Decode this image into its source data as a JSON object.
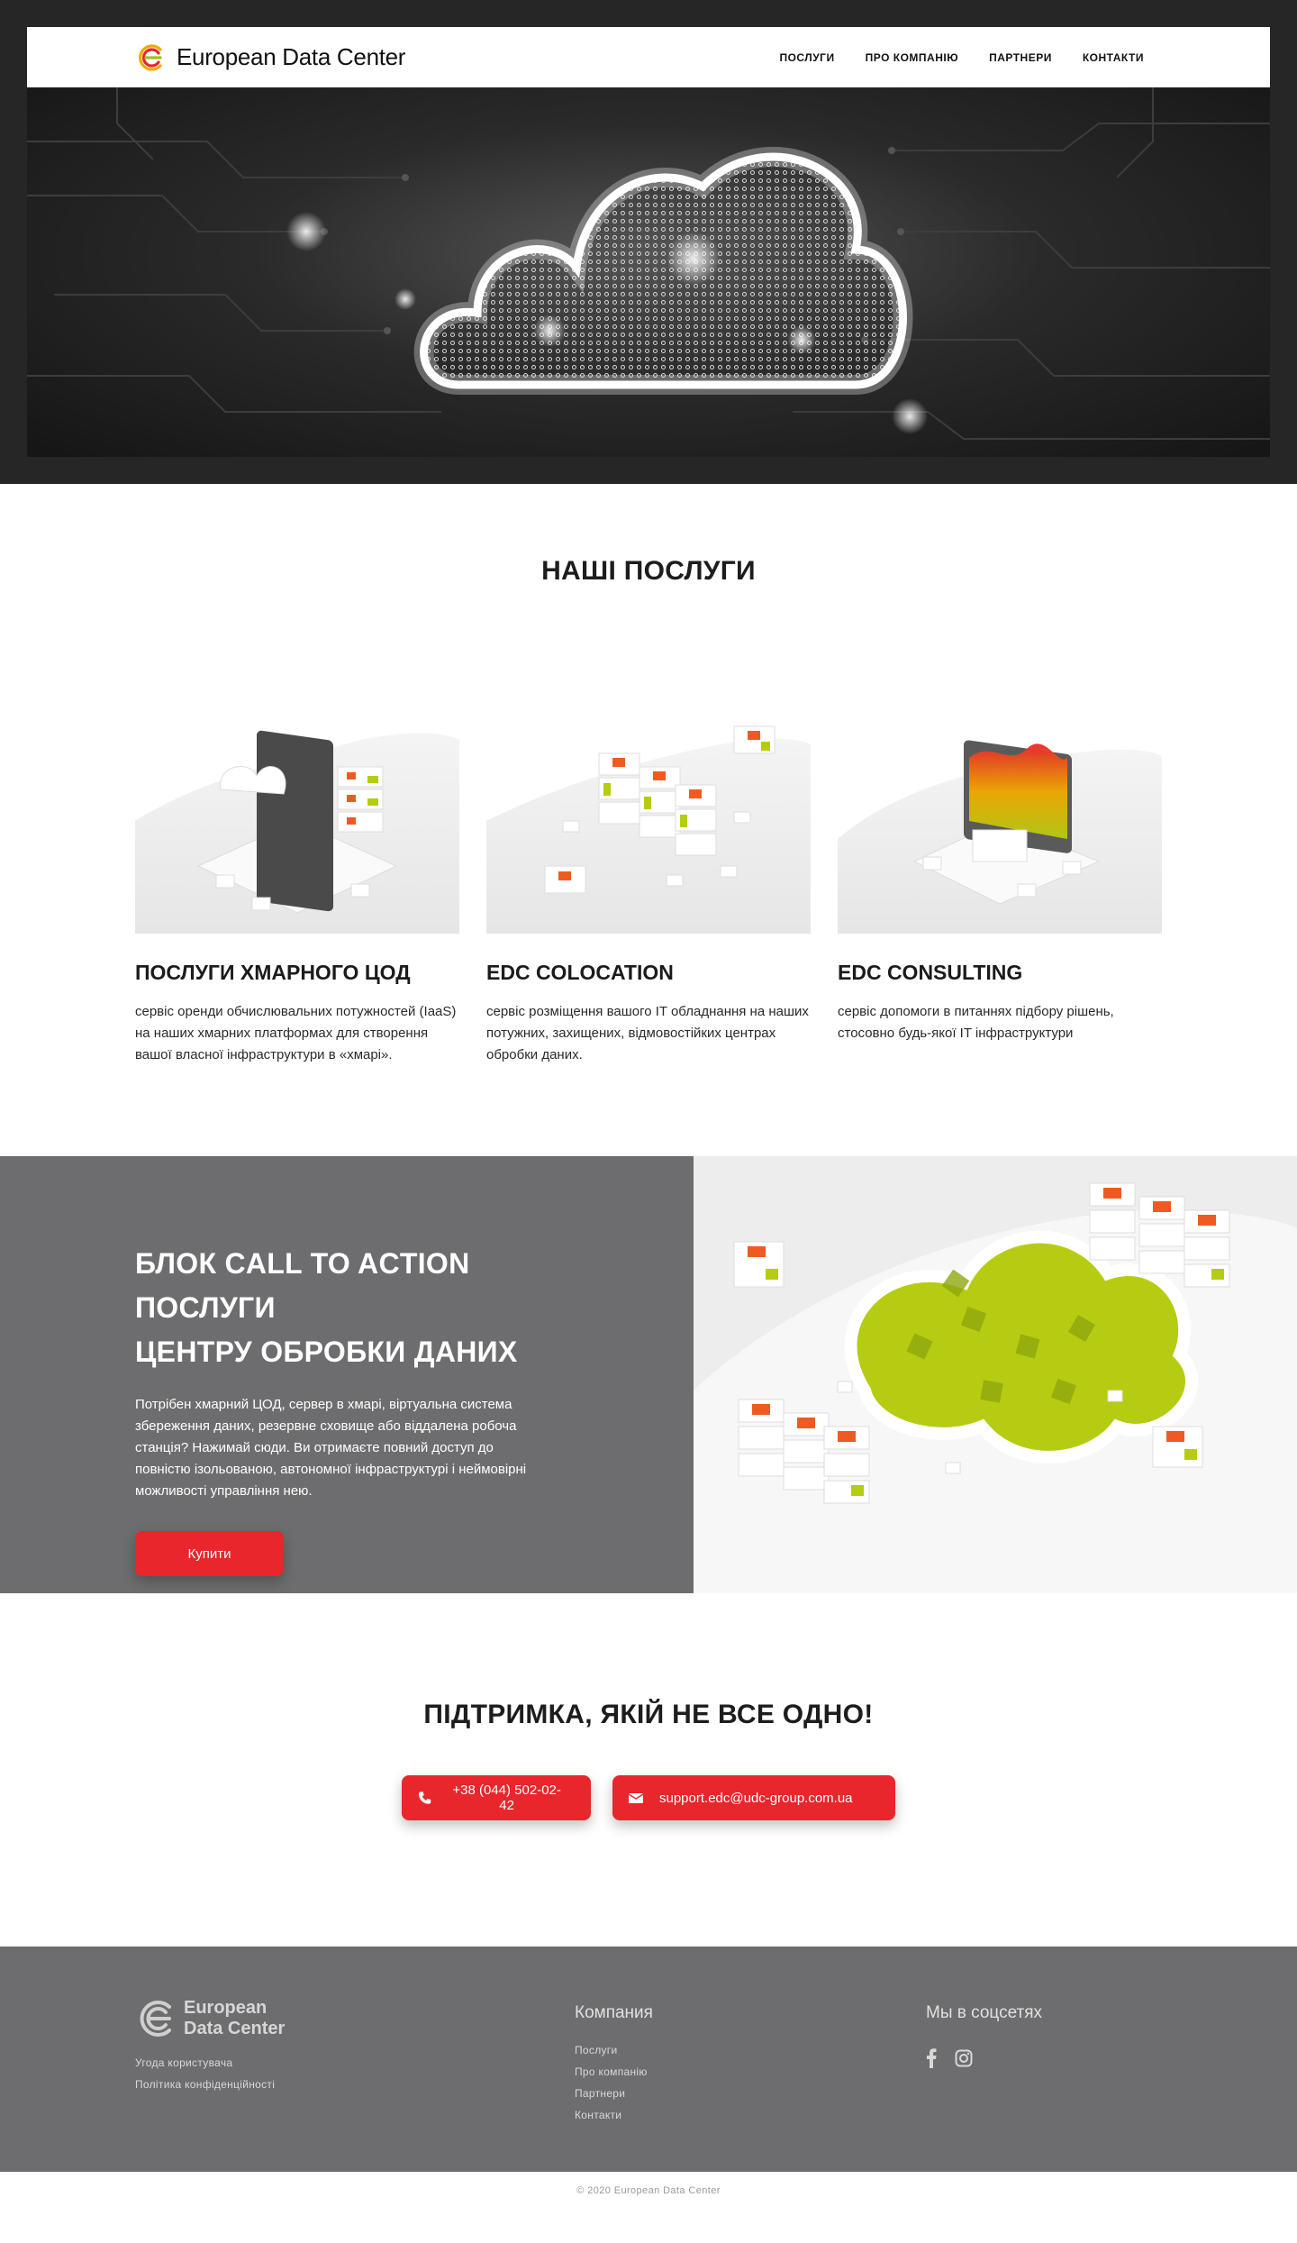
{
  "brand": {
    "name": "European Data Center"
  },
  "nav": {
    "items": [
      "ПОСЛУГИ",
      "ПРО КОМПАНІЮ",
      "ПАРТНЕРИ",
      "КОНТАКТИ"
    ]
  },
  "services": {
    "title": "НАШІ ПОСЛУГИ",
    "cards": [
      {
        "title": "ПОСЛУГИ ХМАРНОГО ЦОД",
        "text": "сервіс оренди обчислювальних потужностей (IaaS) на наших хмарних платформах для створення вашої власної інфраструктури в «хмарі»."
      },
      {
        "title": "EDC COLOCATION",
        "text": "сервіс розміщення вашого IT обладнання на наших потужних, захищених, відмовостійких центрах обробки даних."
      },
      {
        "title": "EDC CONSULTING",
        "text": "сервіс допомоги в питаннях підбору рішень, стосовно будь-якої IT інфраструктури"
      }
    ]
  },
  "cta": {
    "title_line1": "БЛОК CALL TO ACTION ПОСЛУГИ",
    "title_line2": "ЦЕНТРУ ОБРОБКИ ДАНИХ",
    "text": "Потрібен хмарний ЦОД, сервер в хмарі, віртуальна система збереження даних, резервне сховище або віддалена робоча станція? Нажимай сюди. Ви отримаєте повний доступ до повністю ізольованою, автономної інфраструктурі і неймовірні можливості управління нею.",
    "button": "Купити"
  },
  "support": {
    "title": "ПІДТРИМКА, ЯКІЙ НЕ ВСЕ ОДНО!",
    "phone": "+38 (044) 502-02-42",
    "email": "support.edc@udc-group.com.ua"
  },
  "footer": {
    "logo_line1": "European",
    "logo_line2": "Data Center",
    "legal": [
      "Угода користувача",
      "Політика конфіденційності"
    ],
    "company_heading": "Компания",
    "company_links": [
      "Послуги",
      "Про компанію",
      "Партнери",
      "Контакти"
    ],
    "social_heading": "Мы в соцсетях",
    "social_icons": [
      "facebook-icon",
      "instagram-icon"
    ]
  },
  "copyright": "© 2020 European Data Center",
  "colors": {
    "accent": "#e8262b",
    "gray": "#6d6d6f",
    "dark": "#262626",
    "lime": "#b6cc12"
  }
}
